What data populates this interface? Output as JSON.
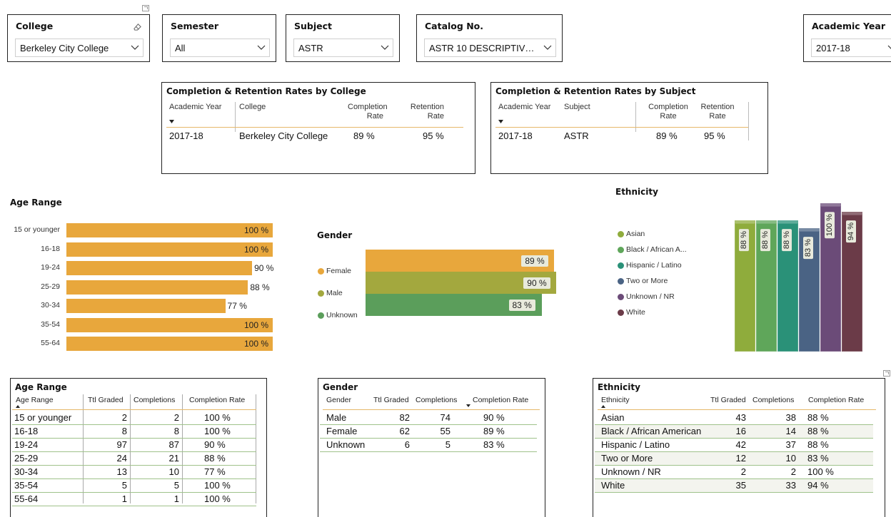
{
  "slicers": {
    "college": {
      "title": "College",
      "value": "Berkeley City College"
    },
    "semester": {
      "title": "Semester",
      "value": "All"
    },
    "subject": {
      "title": "Subject",
      "value": "ASTR"
    },
    "catalog": {
      "title": "Catalog No.",
      "value": "ASTR 10 DESCRIPTIV…"
    },
    "year": {
      "title": "Academic Year",
      "value": "2017-18"
    }
  },
  "college_table": {
    "title": "Completion & Retention Rates by College",
    "headers": [
      "Academic Year",
      "College",
      "Completion Rate",
      "Retention Rate"
    ],
    "row": [
      "2017-18",
      "Berkeley City College",
      "89 %",
      "95 %"
    ]
  },
  "subject_table": {
    "title": "Completion & Retention Rates by Subject",
    "headers": [
      "Academic Year",
      "Subject",
      "Completion Rate",
      "Retention Rate"
    ],
    "row": [
      "2017-18",
      "ASTR",
      "89 %",
      "95 %"
    ]
  },
  "age_chart_title": "Age Range",
  "gender_chart_title": "Gender",
  "ethnicity_chart_title": "Ethnicity",
  "chart_data": [
    {
      "type": "bar",
      "title": "Age Range",
      "orientation": "horizontal",
      "categories": [
        "15 or younger",
        "16-18",
        "19-24",
        "25-29",
        "30-34",
        "35-54",
        "55-64"
      ],
      "values": [
        100,
        100,
        90,
        88,
        77,
        100,
        100
      ],
      "labels": [
        "100 %",
        "100 %",
        "90 %",
        "88 %",
        "77 %",
        "100 %",
        "100 %"
      ],
      "color": "#e8a73c"
    },
    {
      "type": "bar",
      "title": "Gender",
      "orientation": "horizontal",
      "categories": [
        "Female",
        "Male",
        "Unknown"
      ],
      "values": [
        89,
        90,
        83
      ],
      "labels": [
        "89 %",
        "90 %",
        "83 %"
      ],
      "colors": [
        "#e8a73c",
        "#a3a83e",
        "#5b9e5b"
      ],
      "legend": "left"
    },
    {
      "type": "bar",
      "title": "Ethnicity",
      "orientation": "vertical",
      "categories": [
        "Asian",
        "Black / African American",
        "Hispanic / Latino",
        "Two or More",
        "Unknown / NR",
        "White"
      ],
      "legend_labels": [
        "Asian",
        "Black / African A...",
        "Hispanic / Latino",
        "Two or More",
        "Unknown / NR",
        "White"
      ],
      "values": [
        88,
        88,
        88,
        83,
        100,
        94
      ],
      "labels": [
        "88 %",
        "88 %",
        "88 %",
        "83 %",
        "100 %",
        "94 %"
      ],
      "colors": [
        "#8fac3c",
        "#5fa65a",
        "#2a9178",
        "#4a6384",
        "#6b4b78",
        "#6b3b48"
      ],
      "legend": "left"
    }
  ],
  "age_table": {
    "title": "Age Range",
    "headers": [
      "Age Range",
      "Ttl Graded",
      "Completions",
      "Completion Rate"
    ],
    "rows": [
      [
        "15 or younger",
        "2",
        "2",
        "100 %"
      ],
      [
        "16-18",
        "8",
        "8",
        "100 %"
      ],
      [
        "19-24",
        "97",
        "87",
        "90 %"
      ],
      [
        "25-29",
        "24",
        "21",
        "88 %"
      ],
      [
        "30-34",
        "13",
        "10",
        "77 %"
      ],
      [
        "35-54",
        "5",
        "5",
        "100 %"
      ],
      [
        "55-64",
        "1",
        "1",
        "100 %"
      ]
    ]
  },
  "gender_table": {
    "title": "Gender",
    "headers": [
      "Gender",
      "Ttl Graded",
      "Completions",
      "Completion Rate"
    ],
    "rows": [
      [
        "Male",
        "82",
        "74",
        "90 %"
      ],
      [
        "Female",
        "62",
        "55",
        "89 %"
      ],
      [
        "Unknown",
        "6",
        "5",
        "83 %"
      ]
    ]
  },
  "ethnicity_table": {
    "title": "Ethnicity",
    "headers": [
      "Ethnicity",
      "Ttl Graded",
      "Completions",
      "Completion Rate"
    ],
    "rows": [
      [
        "Asian",
        "43",
        "38",
        "88 %"
      ],
      [
        "Black / African American",
        "16",
        "14",
        "88 %"
      ],
      [
        "Hispanic / Latino",
        "42",
        "37",
        "88 %"
      ],
      [
        "Two or More",
        "12",
        "10",
        "83 %"
      ],
      [
        "Unknown / NR",
        "2",
        "2",
        "100 %"
      ],
      [
        "White",
        "35",
        "33",
        "94 %"
      ]
    ]
  }
}
